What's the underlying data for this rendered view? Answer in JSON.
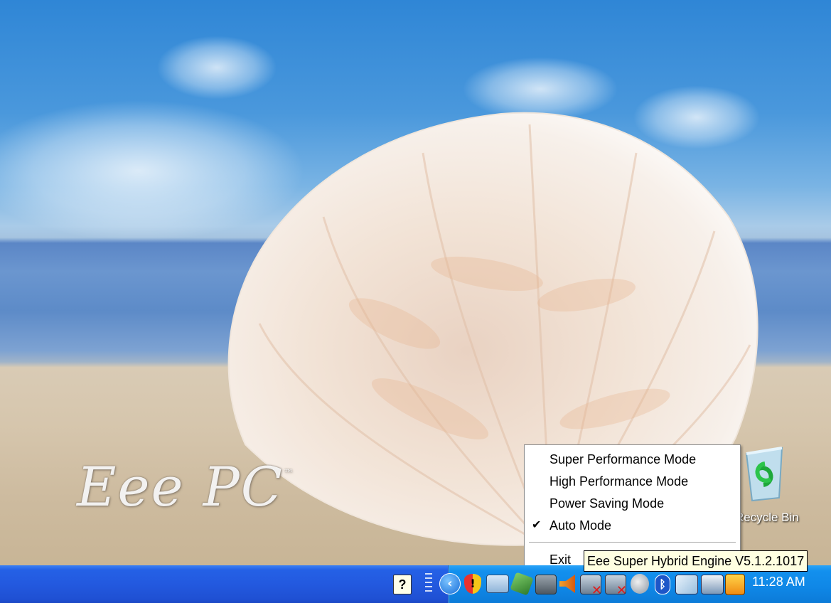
{
  "desktop": {
    "wallpaper": "seashell-on-beach",
    "logo_text": "Eee PC",
    "logo_mark": "™"
  },
  "icons": [
    {
      "name": "recycle-bin",
      "label": "Recycle Bin",
      "icon": "recycle-bin-icon"
    }
  ],
  "context_menu": {
    "items": [
      {
        "label": "Super Performance Mode",
        "checked": false
      },
      {
        "label": "High Performance Mode",
        "checked": false
      },
      {
        "label": "Power Saving Mode",
        "checked": false
      },
      {
        "label": "Auto Mode",
        "checked": true
      },
      {
        "label": "Exit",
        "checked": false
      }
    ],
    "check_glyph": "✔"
  },
  "tooltip": {
    "text": "Eee Super Hybrid Engine V5.1.2.1017"
  },
  "taskbar": {
    "clock": "11:28 AM",
    "tray_icons": [
      "help-icon",
      "quick-launch-grip-icon",
      "show-hidden-icons-chevron-icon",
      "security-shield-icon",
      "wireless-network-icon",
      "usb-device-icon",
      "network-icon",
      "volume-icon",
      "network-disconnected-icon",
      "network-disconnected-icon-2",
      "power-icon",
      "bluetooth-icon",
      "display-icon",
      "touchpad-icon",
      "eee-she-icon"
    ]
  },
  "colors": {
    "taskbar": "#245edb",
    "tray": "#0f8ae8",
    "menu_bg": "#ffffff",
    "tooltip_bg": "#ffffe1"
  }
}
